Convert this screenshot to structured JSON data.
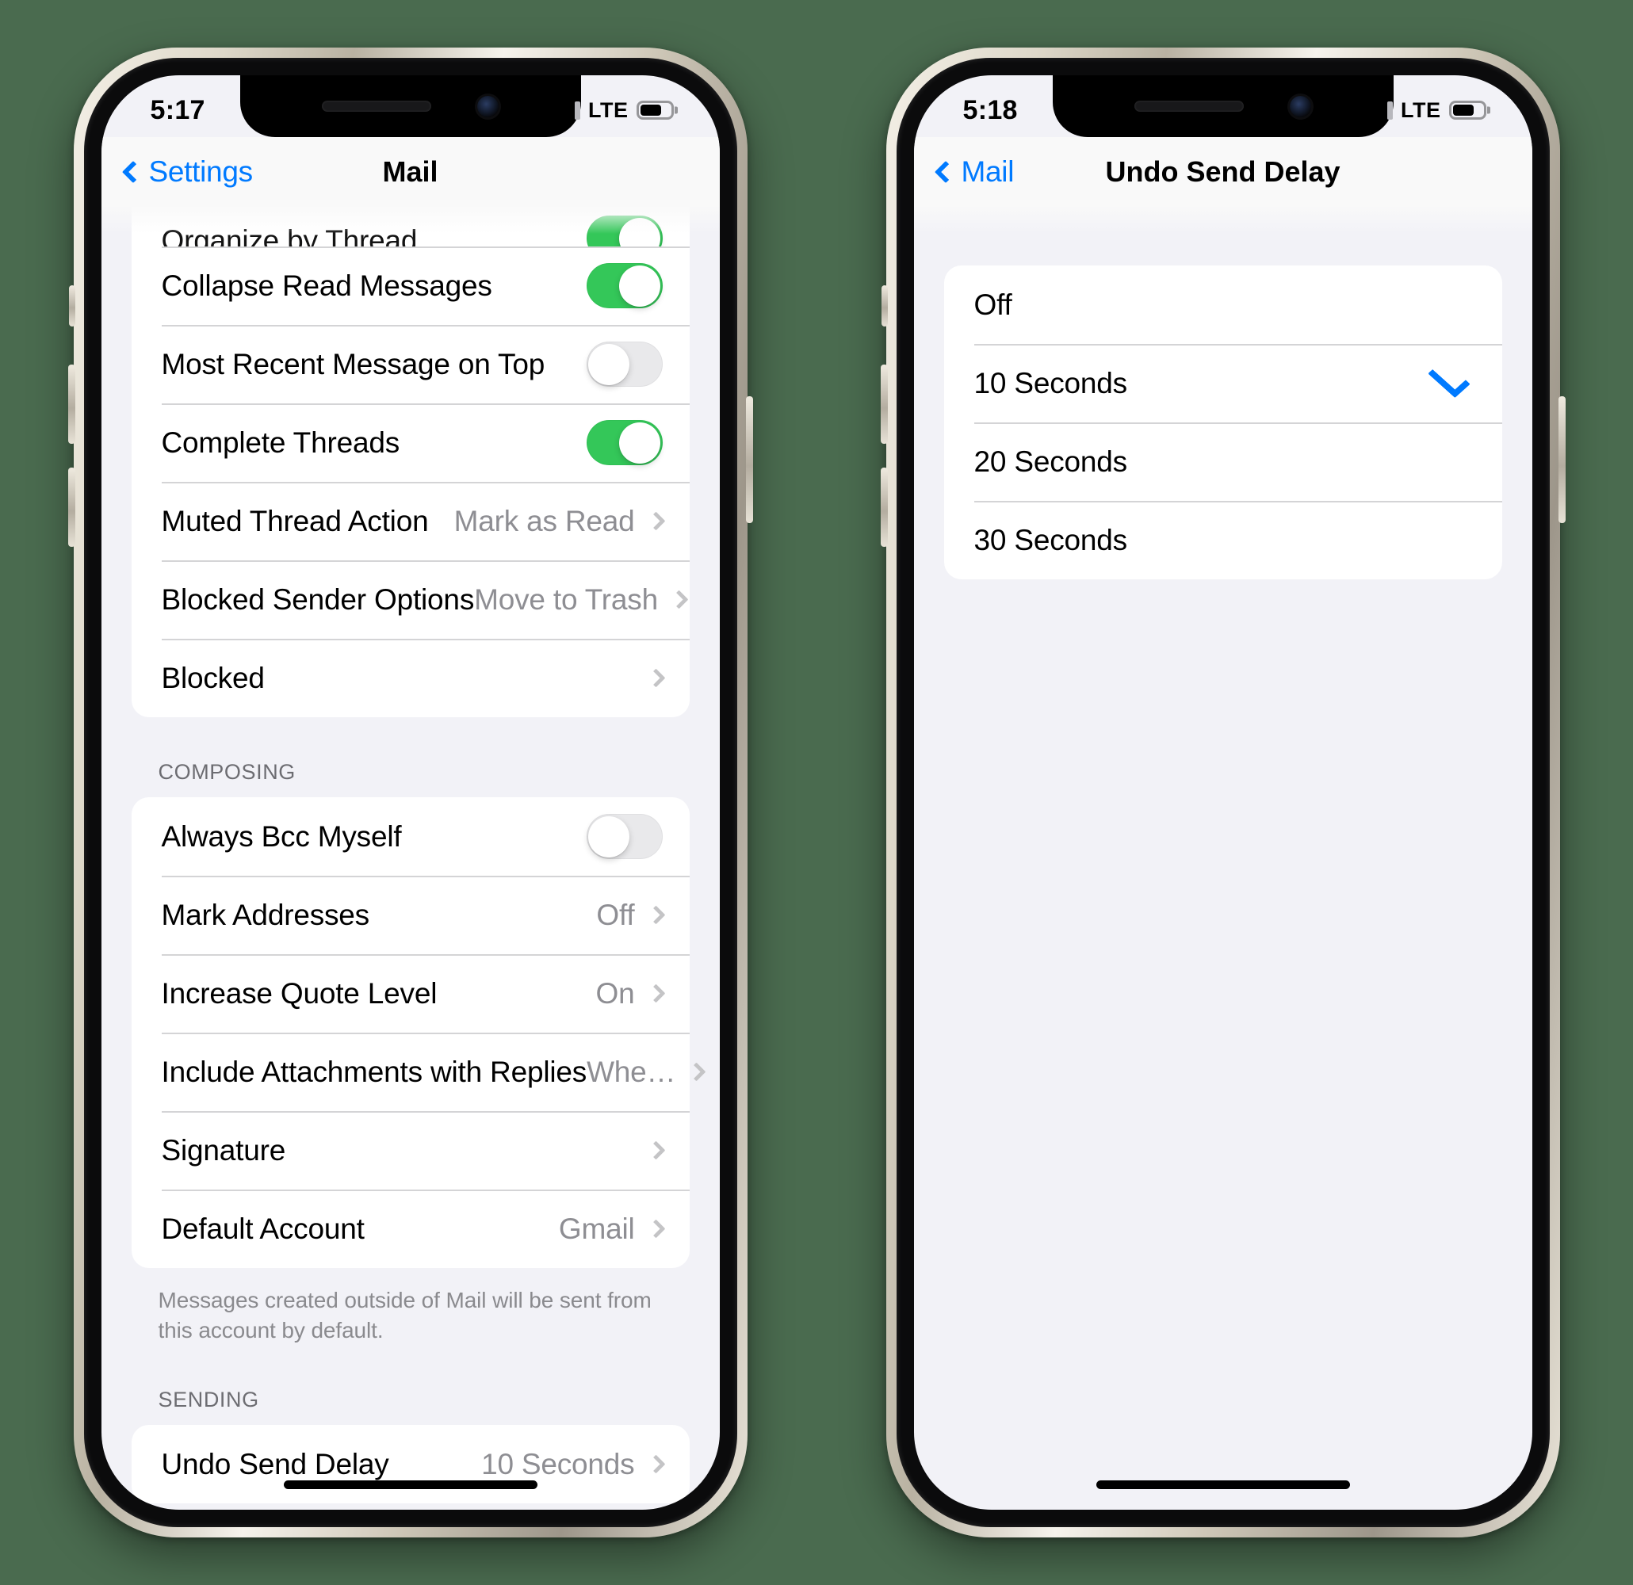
{
  "phone1": {
    "status": {
      "time": "5:17",
      "carrier": "LTE",
      "signal_icon": "signal-bars-icon",
      "battery_icon": "battery-icon"
    },
    "nav": {
      "back_label": "Settings",
      "title": "Mail",
      "back_icon": "chevron-left-icon"
    },
    "group_threading": {
      "rows": [
        {
          "label": "Organize by Thread",
          "type": "toggle",
          "value": "on",
          "clipped": true
        },
        {
          "label": "Collapse Read Messages",
          "type": "toggle",
          "value": "on"
        },
        {
          "label": "Most Recent Message on Top",
          "type": "toggle",
          "value": "off"
        },
        {
          "label": "Complete Threads",
          "type": "toggle",
          "value": "on"
        },
        {
          "label": "Muted Thread Action",
          "type": "disclosure",
          "value": "Mark as Read"
        },
        {
          "label": "Blocked Sender Options",
          "type": "disclosure",
          "value": "Move to Trash"
        },
        {
          "label": "Blocked",
          "type": "disclosure",
          "value": ""
        }
      ]
    },
    "composing": {
      "header": "COMPOSING",
      "rows": [
        {
          "label": "Always Bcc Myself",
          "type": "toggle",
          "value": "off"
        },
        {
          "label": "Mark Addresses",
          "type": "disclosure",
          "value": "Off"
        },
        {
          "label": "Increase Quote Level",
          "type": "disclosure",
          "value": "On"
        },
        {
          "label": "Include Attachments with Replies",
          "type": "disclosure",
          "value": "Whe…"
        },
        {
          "label": "Signature",
          "type": "disclosure",
          "value": ""
        },
        {
          "label": "Default Account",
          "type": "disclosure",
          "value": "Gmail"
        }
      ],
      "footnote": "Messages created outside of Mail will be sent from this account by default."
    },
    "sending": {
      "header": "SENDING",
      "rows": [
        {
          "label": "Undo Send Delay",
          "type": "disclosure",
          "value": "10 Seconds"
        }
      ]
    }
  },
  "phone2": {
    "status": {
      "time": "5:18",
      "carrier": "LTE",
      "signal_icon": "signal-bars-icon",
      "battery_icon": "battery-icon"
    },
    "nav": {
      "back_label": "Mail",
      "title": "Undo Send Delay",
      "back_icon": "chevron-left-icon"
    },
    "options": [
      {
        "label": "Off",
        "selected": false
      },
      {
        "label": "10 Seconds",
        "selected": true
      },
      {
        "label": "20 Seconds",
        "selected": false
      },
      {
        "label": "30 Seconds",
        "selected": false
      }
    ],
    "check_icon": "checkmark-icon"
  },
  "colors": {
    "accent": "#007aff",
    "toggle_on": "#34c759",
    "background": "#f2f2f7",
    "secondary_text": "#8e8e93",
    "canvas": "#4a6b4f"
  }
}
